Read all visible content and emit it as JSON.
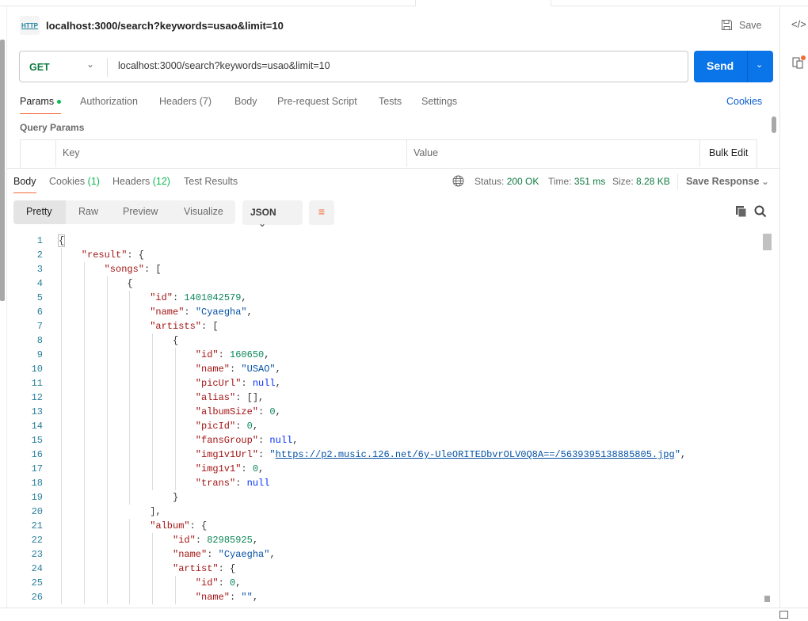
{
  "request": {
    "title": "localhost:3000/search?keywords=usao&limit=10",
    "icon_label": "HTTP",
    "save_label": "Save",
    "method": "GET",
    "url": "localhost:3000/search?keywords=usao&limit=10",
    "send_label": "Send",
    "tabs": [
      {
        "label": "Params",
        "active": true
      },
      {
        "label": "Authorization"
      },
      {
        "label": "Headers (7)"
      },
      {
        "label": "Body"
      },
      {
        "label": "Pre-request Script"
      },
      {
        "label": "Tests"
      },
      {
        "label": "Settings"
      }
    ],
    "cookies_label": "Cookies",
    "query_params_label": "Query Params",
    "table_headers": {
      "key": "Key",
      "value": "Value",
      "bulk_edit": "Bulk Edit"
    }
  },
  "response": {
    "tabs": [
      {
        "label": "Body",
        "active": true
      },
      {
        "label": "Cookies",
        "count": "(1)"
      },
      {
        "label": "Headers",
        "count": "(12)"
      },
      {
        "label": "Test Results"
      }
    ],
    "status_label": "Status:",
    "status_value": "200 OK",
    "time_label": "Time:",
    "time_value": "351 ms",
    "size_label": "Size:",
    "size_value": "8.28 KB",
    "save_response_label": "Save Response",
    "view_modes": [
      "Pretty",
      "Raw",
      "Preview",
      "Visualize"
    ],
    "format": "JSON",
    "code_lines": [
      {
        "i": 0,
        "t": [
          [
            "p",
            "{"
          ]
        ]
      },
      {
        "i": 1,
        "t": [
          [
            "k",
            "\"result\""
          ],
          [
            "p",
            ": {"
          ]
        ]
      },
      {
        "i": 2,
        "t": [
          [
            "k",
            "\"songs\""
          ],
          [
            "p",
            ": ["
          ]
        ]
      },
      {
        "i": 3,
        "t": [
          [
            "p",
            "{"
          ]
        ]
      },
      {
        "i": 4,
        "t": [
          [
            "k",
            "\"id\""
          ],
          [
            "p",
            ": "
          ],
          [
            "n",
            "1401042579"
          ],
          [
            "p",
            ","
          ]
        ]
      },
      {
        "i": 4,
        "t": [
          [
            "k",
            "\"name\""
          ],
          [
            "p",
            ": "
          ],
          [
            "s",
            "\"Cyaegha\""
          ],
          [
            "p",
            ","
          ]
        ]
      },
      {
        "i": 4,
        "t": [
          [
            "k",
            "\"artists\""
          ],
          [
            "p",
            ": ["
          ]
        ]
      },
      {
        "i": 5,
        "t": [
          [
            "p",
            "{"
          ]
        ]
      },
      {
        "i": 6,
        "t": [
          [
            "k",
            "\"id\""
          ],
          [
            "p",
            ": "
          ],
          [
            "n",
            "160650"
          ],
          [
            "p",
            ","
          ]
        ]
      },
      {
        "i": 6,
        "t": [
          [
            "k",
            "\"name\""
          ],
          [
            "p",
            ": "
          ],
          [
            "s",
            "\"USAO\""
          ],
          [
            "p",
            ","
          ]
        ]
      },
      {
        "i": 6,
        "t": [
          [
            "k",
            "\"picUrl\""
          ],
          [
            "p",
            ": "
          ],
          [
            "l",
            "null"
          ],
          [
            "p",
            ","
          ]
        ]
      },
      {
        "i": 6,
        "t": [
          [
            "k",
            "\"alias\""
          ],
          [
            "p",
            ": [],"
          ]
        ]
      },
      {
        "i": 6,
        "t": [
          [
            "k",
            "\"albumSize\""
          ],
          [
            "p",
            ": "
          ],
          [
            "n",
            "0"
          ],
          [
            "p",
            ","
          ]
        ]
      },
      {
        "i": 6,
        "t": [
          [
            "k",
            "\"picId\""
          ],
          [
            "p",
            ": "
          ],
          [
            "n",
            "0"
          ],
          [
            "p",
            ","
          ]
        ]
      },
      {
        "i": 6,
        "t": [
          [
            "k",
            "\"fansGroup\""
          ],
          [
            "p",
            ": "
          ],
          [
            "l",
            "null"
          ],
          [
            "p",
            ","
          ]
        ]
      },
      {
        "i": 6,
        "t": [
          [
            "k",
            "\"img1v1Url\""
          ],
          [
            "p",
            ": "
          ],
          [
            "s",
            "\""
          ],
          [
            "u",
            "https://p2.music.126.net/6y-UleORITEDbvrOLV0Q8A==/5639395138885805.jpg"
          ],
          [
            "s",
            "\""
          ],
          [
            "p",
            ","
          ]
        ]
      },
      {
        "i": 6,
        "t": [
          [
            "k",
            "\"img1v1\""
          ],
          [
            "p",
            ": "
          ],
          [
            "n",
            "0"
          ],
          [
            "p",
            ","
          ]
        ]
      },
      {
        "i": 6,
        "t": [
          [
            "k",
            "\"trans\""
          ],
          [
            "p",
            ": "
          ],
          [
            "l",
            "null"
          ]
        ]
      },
      {
        "i": 5,
        "t": [
          [
            "p",
            "}"
          ]
        ]
      },
      {
        "i": 4,
        "t": [
          [
            "p",
            "],"
          ]
        ]
      },
      {
        "i": 4,
        "t": [
          [
            "k",
            "\"album\""
          ],
          [
            "p",
            ": {"
          ]
        ]
      },
      {
        "i": 5,
        "t": [
          [
            "k",
            "\"id\""
          ],
          [
            "p",
            ": "
          ],
          [
            "n",
            "82985925"
          ],
          [
            "p",
            ","
          ]
        ]
      },
      {
        "i": 5,
        "t": [
          [
            "k",
            "\"name\""
          ],
          [
            "p",
            ": "
          ],
          [
            "s",
            "\"Cyaegha\""
          ],
          [
            "p",
            ","
          ]
        ]
      },
      {
        "i": 5,
        "t": [
          [
            "k",
            "\"artist\""
          ],
          [
            "p",
            ": {"
          ]
        ]
      },
      {
        "i": 6,
        "t": [
          [
            "k",
            "\"id\""
          ],
          [
            "p",
            ": "
          ],
          [
            "n",
            "0"
          ],
          [
            "p",
            ","
          ]
        ]
      },
      {
        "i": 6,
        "t": [
          [
            "k",
            "\"name\""
          ],
          [
            "p",
            ": "
          ],
          [
            "s",
            "\"\""
          ],
          [
            "p",
            ","
          ]
        ]
      }
    ]
  },
  "colors": {
    "send": "#0a75e8",
    "accent": "#f26b3a",
    "link": "#0a5fd1",
    "success": "#0cbb52"
  }
}
